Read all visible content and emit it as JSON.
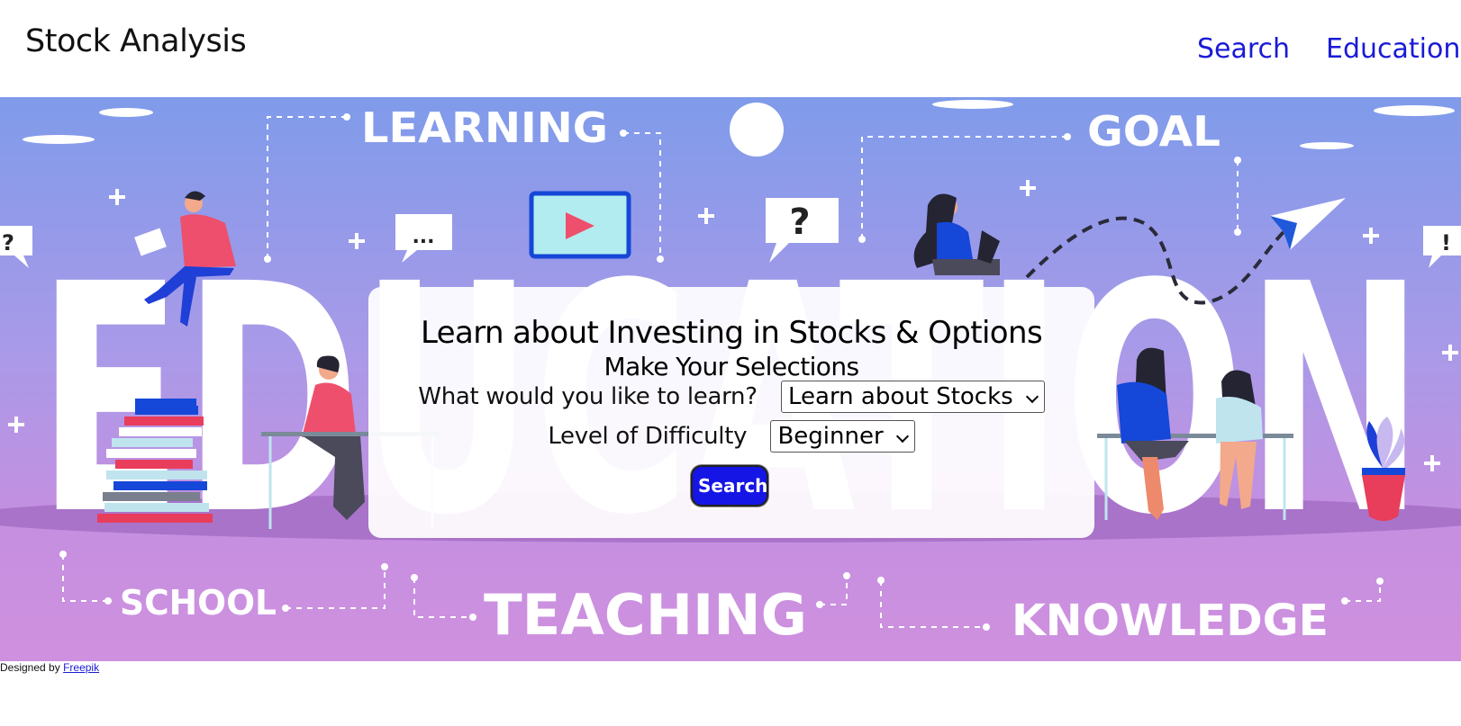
{
  "header": {
    "brand": "Stock Analysis",
    "nav": {
      "search": "Search",
      "education": "Education"
    }
  },
  "hero": {
    "words": {
      "learning": "LEARNING",
      "goal": "GOAL",
      "education": "EDUCATION",
      "school": "SCHOOL",
      "teaching": "TEACHING",
      "knowledge": "KNOWLEDGE"
    },
    "bubbles": {
      "question": "?",
      "dots": "...",
      "exclamation": "!"
    }
  },
  "card": {
    "title": "Learn about Investing in Stocks & Options",
    "subtitle": "Make Your Selections",
    "learn_label": "What would you like to learn?",
    "learn_selected": "Learn about Stocks",
    "difficulty_label": "Level of Difficulty",
    "difficulty_selected": "Beginner",
    "search_button": "Search"
  },
  "footer": {
    "credit_prefix": "Designed by",
    "credit_link": "Freepik"
  },
  "colors": {
    "nav_link": "#1a1ad6",
    "button": "#1515e6",
    "hero_top": "#7f9bea",
    "hero_bottom": "#cf90df"
  }
}
